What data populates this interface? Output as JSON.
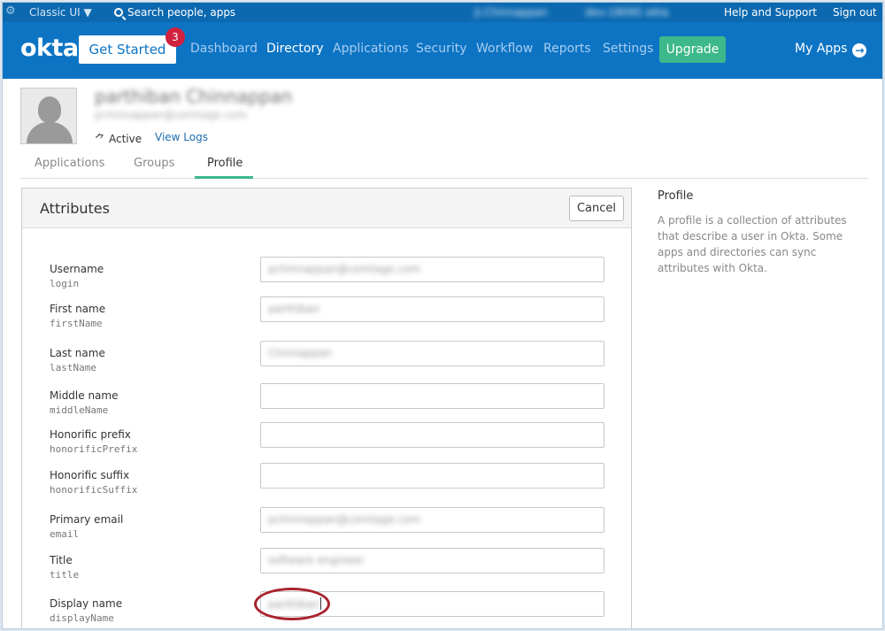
{
  "topbar": {
    "classic_ui": "Classic UI ▼",
    "search_placeholder": "Search people, apps",
    "account_name": "jl.Chinnappan",
    "org_name": "dev-18095 okta",
    "help": "Help and Support",
    "signout": "Sign out"
  },
  "nav": {
    "logo": "okta",
    "get_started": "Get Started",
    "badge_count": "3",
    "links": [
      "Dashboard",
      "Directory",
      "Applications",
      "Security",
      "Workflow",
      "Reports",
      "Settings"
    ],
    "active": "Directory",
    "upgrade": "Upgrade",
    "my_apps": "My Apps"
  },
  "user": {
    "name": "parthiban Chinnappan",
    "email": "pchinnappan@cemtage.com",
    "status": "Active",
    "view_logs": "View Logs"
  },
  "tabs": [
    "Applications",
    "Groups",
    "Profile"
  ],
  "active_tab": "Profile",
  "panel": {
    "title": "Attributes",
    "cancel": "Cancel"
  },
  "fields": [
    {
      "label": "Username",
      "key": "login",
      "value": "pchinnappan@cemtage.com"
    },
    {
      "label": "First name",
      "key": "firstName",
      "value": "parthiban"
    },
    {
      "label": "Last name",
      "key": "lastName",
      "value": "Chinnappan"
    },
    {
      "label": "Middle name",
      "key": "middleName",
      "value": ""
    },
    {
      "label": "Honorific prefix",
      "key": "honorificPrefix",
      "value": ""
    },
    {
      "label": "Honorific suffix",
      "key": "honorificSuffix",
      "value": ""
    },
    {
      "label": "Primary email",
      "key": "email",
      "value": "pchinnappan@cemtage.com"
    },
    {
      "label": "Title",
      "key": "title",
      "value": "software engineer"
    },
    {
      "label": "Display name",
      "key": "displayName",
      "value": "parthiban"
    }
  ],
  "sidebar": {
    "title": "Profile",
    "text": "A profile is a collection of attributes that describe a user in Okta. Some apps and directories can sync attributes with Okta."
  },
  "colors": {
    "nav_blue": "#0d74c4",
    "top_blue": "#0c69b0",
    "upgrade_green": "#3cb88b",
    "badge_red": "#d0213f",
    "highlight_red": "#a8232c"
  }
}
